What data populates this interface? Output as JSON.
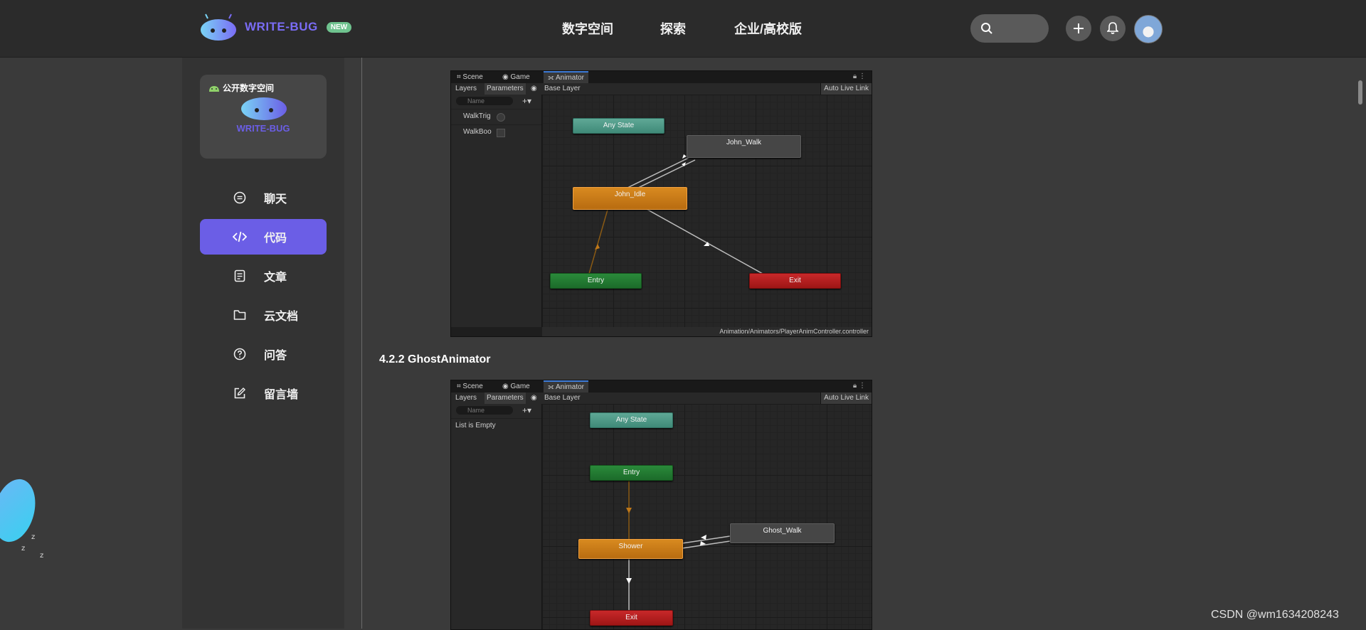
{
  "header": {
    "brand": "WRITE-BUG",
    "badge": "NEW",
    "nav": [
      "数字空间",
      "探索",
      "企业/高校版"
    ]
  },
  "icons": {
    "search": "search-icon",
    "add": "plus-icon",
    "notifications": "bell-icon",
    "profile": "avatar"
  },
  "sidebar": {
    "workspace_label": "公开数字空间",
    "workspace_brand": "WRITE-BUG",
    "items": [
      {
        "label": "聊天",
        "icon": "chat-icon"
      },
      {
        "label": "代码",
        "icon": "code-icon",
        "active": true
      },
      {
        "label": "文章",
        "icon": "document-icon"
      },
      {
        "label": "云文档",
        "icon": "folder-icon"
      },
      {
        "label": "问答",
        "icon": "question-icon"
      },
      {
        "label": "留言墙",
        "icon": "edit-icon"
      }
    ]
  },
  "article": {
    "section_heading": "4.2.2 GhostAnimator",
    "panel1": {
      "tabs": [
        "Scene",
        "Game",
        "Animator"
      ],
      "toolbar": {
        "layers": "Layers",
        "parameters": "Parameters",
        "base_layer": "Base Layer",
        "auto_live": "Auto Live Link"
      },
      "filter_placeholder": "Name",
      "params": [
        "WalkTrig",
        "WalkBoo"
      ],
      "states": {
        "any": "Any State",
        "walk": "John_Walk",
        "idle": "John_Idle",
        "entry": "Entry",
        "exit": "Exit"
      },
      "path": "Animation/Animators/PlayerAnimController.controller"
    },
    "panel2": {
      "tabs": [
        "Scene",
        "Game",
        "Animator"
      ],
      "toolbar": {
        "layers": "Layers",
        "parameters": "Parameters",
        "base_layer": "Base Layer",
        "auto_live": "Auto Live Link"
      },
      "filter_placeholder": "Name",
      "empty_text": "List is Empty",
      "states": {
        "any": "Any State",
        "entry": "Entry",
        "shower": "Shower",
        "walk": "Ghost_Walk",
        "exit": "Exit"
      }
    }
  },
  "watermark": "CSDN @wm1634208243",
  "colors": {
    "accent": "#6b5ee6",
    "brand": "#7a6cf5",
    "badge": "#6fc38f"
  }
}
